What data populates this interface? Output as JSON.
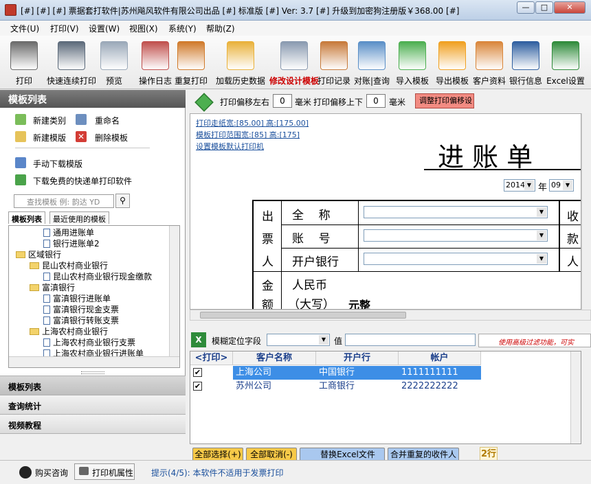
{
  "window": {
    "title": "[#] [#] [#] 票据套打软件|苏州飚风软件有限公司出品 [#] 标准版 [#]  Ver: 3.7  [#]      升级到加密狗注册版￥368.00 [#]",
    "minimize": "—",
    "maximize": "□",
    "close": "✕"
  },
  "menu": [
    "文件(U)",
    "打印(V)",
    "设置(W)",
    "视图(X)",
    "系统(Y)",
    "帮助(Z)"
  ],
  "toolbar": [
    {
      "label": "打印",
      "icon": "printer-icon",
      "color": "#6b6b6b"
    },
    {
      "label": "快速连续打印",
      "icon": "fast-print-icon",
      "color": "#5c6a7a"
    },
    {
      "label": "预览",
      "icon": "magnifier-icon",
      "color": "#9aa8b8"
    },
    {
      "label": "操作日志",
      "icon": "user-log-icon",
      "color": "#c0504d"
    },
    {
      "label": "重复打印",
      "icon": "reprint-icon",
      "color": "#d07a2a"
    },
    {
      "label": "加载历史数据",
      "icon": "history-folder-icon",
      "color": "#e9b13a"
    },
    {
      "label": "修改设计模板",
      "icon": "design-template-icon",
      "color": "#8a9ab0"
    },
    {
      "label": "打印记录",
      "icon": "clipboard-icon",
      "color": "#c77a3a"
    },
    {
      "label": "对账|查询",
      "icon": "reconcile-icon",
      "color": "#5a8fc7"
    },
    {
      "label": "导入模板",
      "icon": "import-arrow-icon",
      "color": "#4caf50"
    },
    {
      "label": "导出模板",
      "icon": "export-arrow-icon",
      "color": "#f0a020"
    },
    {
      "label": "客户资料",
      "icon": "customers-icon",
      "color": "#d9863a"
    },
    {
      "label": "银行信息",
      "icon": "bank-icon",
      "color": "#2f5fa0"
    },
    {
      "label": "Excel设置",
      "icon": "excel-icon",
      "color": "#2e8b3a"
    }
  ],
  "left_panel": {
    "title": "模板列表",
    "actions": [
      {
        "label": "新建类别",
        "icon": "new-category-icon"
      },
      {
        "label": "重命名",
        "icon": "rename-icon"
      },
      {
        "label": "新建模版",
        "icon": "new-template-icon"
      },
      {
        "label": "删除模板",
        "icon": "delete-icon"
      },
      {
        "label": "手动下载模版",
        "icon": "download-icon"
      },
      {
        "label": "下载免费的快递单打印软件",
        "icon": "down-arrow-icon"
      }
    ],
    "search_placeholder": "查找模板 例: 韵达 YD",
    "tabs": [
      "模板列表",
      "最近使用的模板"
    ],
    "tree": [
      {
        "label": "通用进账单",
        "level": 2,
        "type": "doc"
      },
      {
        "label": "银行进账单2",
        "level": 2,
        "type": "doc"
      },
      {
        "label": "区域银行",
        "level": 0,
        "type": "folder"
      },
      {
        "label": "昆山农村商业银行",
        "level": 1,
        "type": "folder"
      },
      {
        "label": "昆山农村商业银行现金缴款",
        "level": 2,
        "type": "doc"
      },
      {
        "label": "富滇银行",
        "level": 1,
        "type": "folder"
      },
      {
        "label": "富滇银行进账单",
        "level": 2,
        "type": "doc"
      },
      {
        "label": "富滇银行现金支票",
        "level": 2,
        "type": "doc"
      },
      {
        "label": "富滇银行转账支票",
        "level": 2,
        "type": "doc"
      },
      {
        "label": "上海农村商业银行",
        "level": 1,
        "type": "folder"
      },
      {
        "label": "上海农村商业银行支票",
        "level": 2,
        "type": "doc"
      },
      {
        "label": "上海农村商业银行进账单",
        "level": 2,
        "type": "doc"
      }
    ],
    "accordion": [
      "模板列表",
      "查询统计",
      "视频教程"
    ]
  },
  "offsets": {
    "lr_label": "打印偏移左右",
    "lr_value": "0",
    "lr_unit": "毫米",
    "ud_label": "打印偏移上下",
    "ud_value": "0",
    "ud_unit": "毫米",
    "adjust_button": "调整打印偏移设"
  },
  "template": {
    "paper_link": "打印走纸宽:[85.00] 高:[175.00]",
    "range_link": "模板打印范围宽:[85] 高:[175]",
    "printer_link": "设置模板默认打印机",
    "heading": "进  账  单",
    "year": "2014",
    "year_unit": "年",
    "month": "09",
    "payer_label": [
      "出",
      "票",
      "人"
    ],
    "payee_label": [
      "收",
      "款",
      "人"
    ],
    "field_name": "全    称",
    "field_account": "账    号",
    "field_bank": "开户银行",
    "amount_label": [
      "金",
      "额"
    ],
    "currency": "人民币",
    "capital": "（大写）",
    "capital_unit": "元整"
  },
  "filter": {
    "label": "模糊定位字段",
    "value_label": "值",
    "hint": "使用高级过滤功能，可实"
  },
  "grid": {
    "headers": [
      "<打印>",
      "客户名称",
      "开户行",
      "帐户"
    ],
    "rows": [
      {
        "checked": true,
        "name": "上海公司",
        "bank": "中国银行",
        "account": "1111111111",
        "selected": true
      },
      {
        "checked": true,
        "name": "苏州公司",
        "bank": "工商银行",
        "account": "2222222222",
        "selected": false
      }
    ]
  },
  "bottom_buttons": [
    "全部选择(+)",
    "全部取消(-)",
    "替换Excel文件",
    "合并重复的收件人"
  ],
  "row_count": "2行",
  "status": {
    "consult": "购买咨询",
    "printer_props": "打印机属性",
    "tip": "提示(4/5): 本软件不适用于发票打印"
  },
  "colors": {
    "selected_row": "#3d8ee6",
    "accent_red": "#cc0000",
    "link_blue": "#1a4f9c"
  }
}
